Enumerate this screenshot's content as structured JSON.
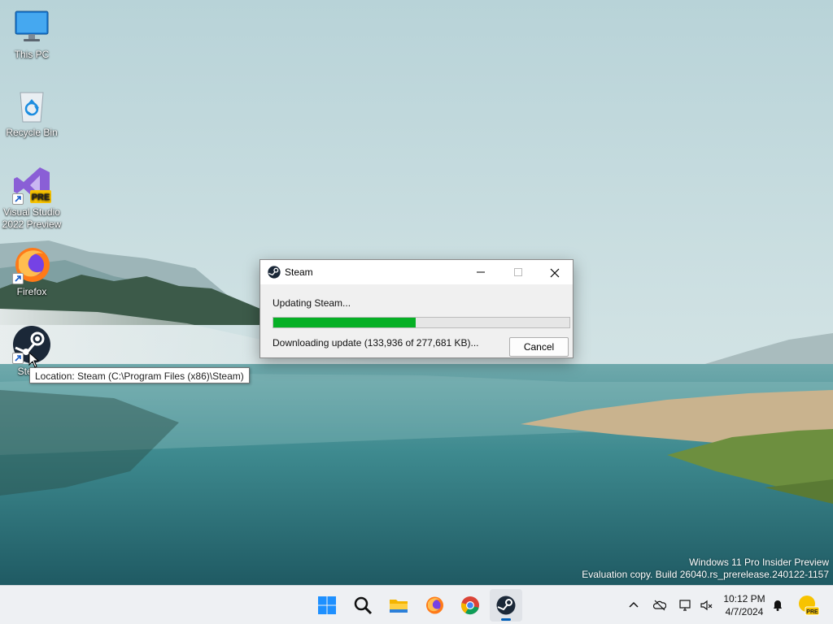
{
  "desktop": {
    "icons": [
      {
        "label": "This PC"
      },
      {
        "label": "Recycle Bin"
      },
      {
        "label": "Visual Studio 2022 Preview",
        "badge": "PRE"
      },
      {
        "label": "Firefox"
      },
      {
        "label": "Steam"
      }
    ],
    "tooltip": "Location: Steam (C:\\Program Files (x86)\\Steam)"
  },
  "dialog": {
    "title": "Steam",
    "status": "Updating Steam...",
    "progress": 0.48,
    "download_text": "Downloading update (133,936 of 277,681 KB)...",
    "cancel_label": "Cancel"
  },
  "watermark": {
    "line1": "Windows 11 Pro Insider Preview",
    "line2": "Evaluation copy. Build 26040.rs_prerelease.240122-1157"
  },
  "taskbar": {
    "apps": [
      "start-icon",
      "search-icon",
      "file-explorer-icon",
      "firefox-icon",
      "chrome-icon",
      "steam-icon"
    ],
    "active_app": "steam-icon",
    "tray": [
      "chevron-up-icon",
      "onedrive-icon",
      "network-icon",
      "volume-mute-icon",
      "notification-bell-icon",
      "insider-badge-icon"
    ],
    "insider_badge": "PRE",
    "clock": {
      "time": "10:12 PM",
      "date": "4/7/2024"
    }
  },
  "colors": {
    "progress_fill": "#06b025",
    "accent": "#005fb8"
  }
}
